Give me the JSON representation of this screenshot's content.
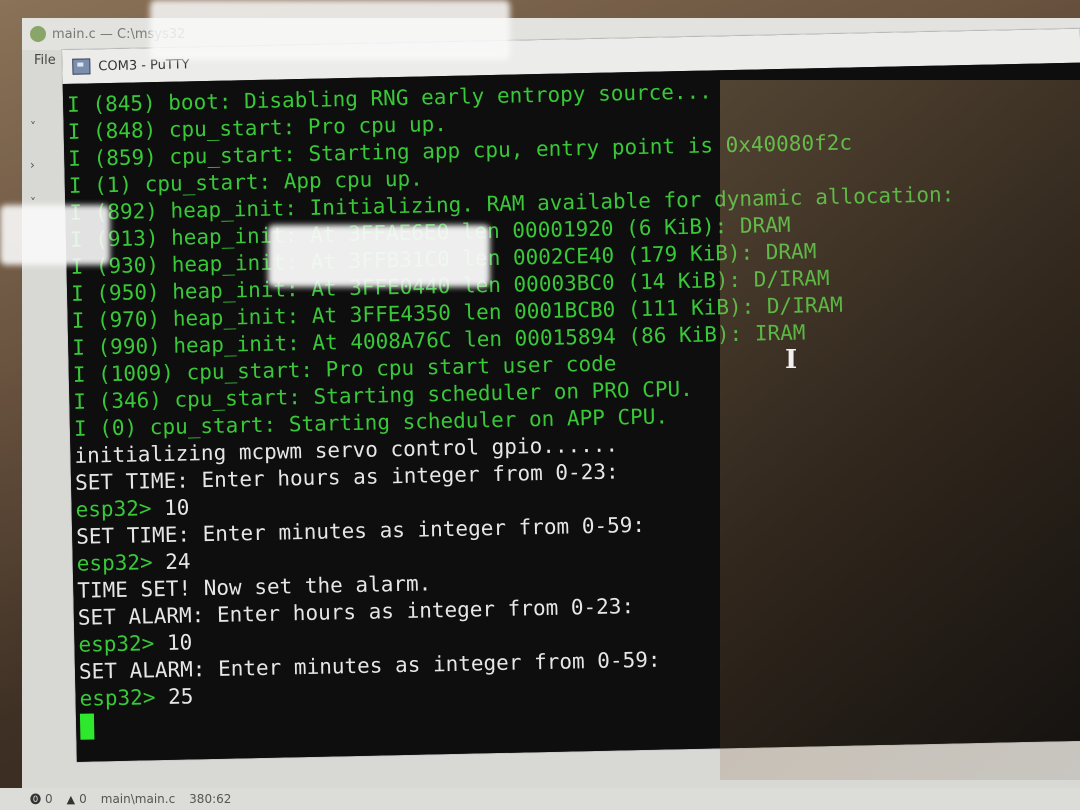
{
  "editor": {
    "title": "main.c — C:\\msys32",
    "menu_file": "File",
    "explorer_chevrons": [
      "˅",
      "›",
      "˅"
    ],
    "status": {
      "errors": "0",
      "warnings": "0",
      "file": "main\\main.c",
      "position": "380:62"
    }
  },
  "putty": {
    "title": "COM3 - PuTTY"
  },
  "terminal": {
    "lines": [
      {
        "text": "I (845) boot: Disabling RNG early entropy source...",
        "color": "green"
      },
      {
        "text": "I (848) cpu_start: Pro cpu up.",
        "color": "green"
      },
      {
        "text": "I (859) cpu_start: Starting app cpu, entry point is 0x40080f2c",
        "color": "green"
      },
      {
        "text": "I (1) cpu_start: App cpu up.",
        "color": "green"
      },
      {
        "text": "I (892) heap_init: Initializing. RAM available for dynamic allocation:",
        "color": "green"
      },
      {
        "text": "I (913) heap_init: At 3FFAE6E0 len 00001920 (6 KiB): DRAM",
        "color": "green"
      },
      {
        "text": "I (930) heap_init: At 3FFB31C0 len 0002CE40 (179 KiB): DRAM",
        "color": "green"
      },
      {
        "text": "I (950) heap_init: At 3FFE0440 len 00003BC0 (14 KiB): D/IRAM",
        "color": "green"
      },
      {
        "text": "I (970) heap_init: At 3FFE4350 len 0001BCB0 (111 KiB): D/IRAM",
        "color": "green"
      },
      {
        "text": "I (990) heap_init: At 4008A76C len 00015894 (86 KiB): IRAM",
        "color": "green"
      },
      {
        "text": "I (1009) cpu_start: Pro cpu start user code",
        "color": "green"
      },
      {
        "text": "I (346) cpu_start: Starting scheduler on PRO CPU.",
        "color": "green"
      },
      {
        "text": "I (0) cpu_start: Starting scheduler on APP CPU.",
        "color": "green"
      },
      {
        "text": "initializing mcpwm servo control gpio......",
        "color": "white"
      },
      {
        "text": "SET TIME: Enter hours as integer from 0-23:",
        "color": "white"
      },
      {
        "text": "esp32> ",
        "input": "10",
        "color": "prompt"
      },
      {
        "text": "SET TIME: Enter minutes as integer from 0-59:",
        "color": "white"
      },
      {
        "text": "esp32> ",
        "input": "24",
        "color": "prompt"
      },
      {
        "text": "TIME SET! Now set the alarm.",
        "color": "white"
      },
      {
        "text": "SET ALARM: Enter hours as integer from 0-23:",
        "color": "white"
      },
      {
        "text": "esp32> ",
        "input": "10",
        "color": "prompt"
      },
      {
        "text": "SET ALARM: Enter minutes as integer from 0-59:",
        "color": "white"
      },
      {
        "text": "esp32> ",
        "input": "25",
        "color": "prompt"
      }
    ],
    "cursor_visible": true
  },
  "colors": {
    "log_green": "#38c838",
    "output_white": "#e6e6e6",
    "cursor_green": "#2ee82e",
    "terminal_bg": "#0e0e0e"
  }
}
